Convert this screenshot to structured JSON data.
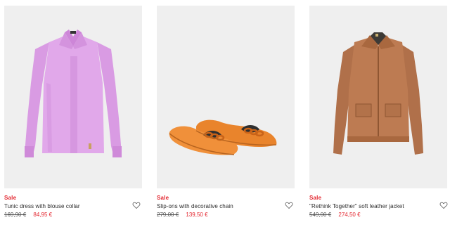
{
  "products": [
    {
      "badge": "Sale",
      "name": "Tunic dress with blouse collar",
      "old_price": "169,90 €",
      "new_price": "84,95 €",
      "image": "lilac-blouse",
      "wishlist_icon": "heart-outline-icon"
    },
    {
      "badge": "Sale",
      "name": "Slip-ons with decorative chain",
      "old_price": "279,00 €",
      "new_price": "139,50 €",
      "image": "orange-suede-loafers",
      "wishlist_icon": "heart-outline-icon"
    },
    {
      "badge": "Sale",
      "name": "\"Rethink Together\" soft leather jacket",
      "old_price": "549,00 €",
      "new_price": "274,50 €",
      "image": "camel-leather-jacket",
      "wishlist_icon": "heart-outline-icon"
    }
  ],
  "colors": {
    "sale_red": "#e3262f",
    "image_background": "#efefef",
    "text": "#2a2a2a"
  }
}
